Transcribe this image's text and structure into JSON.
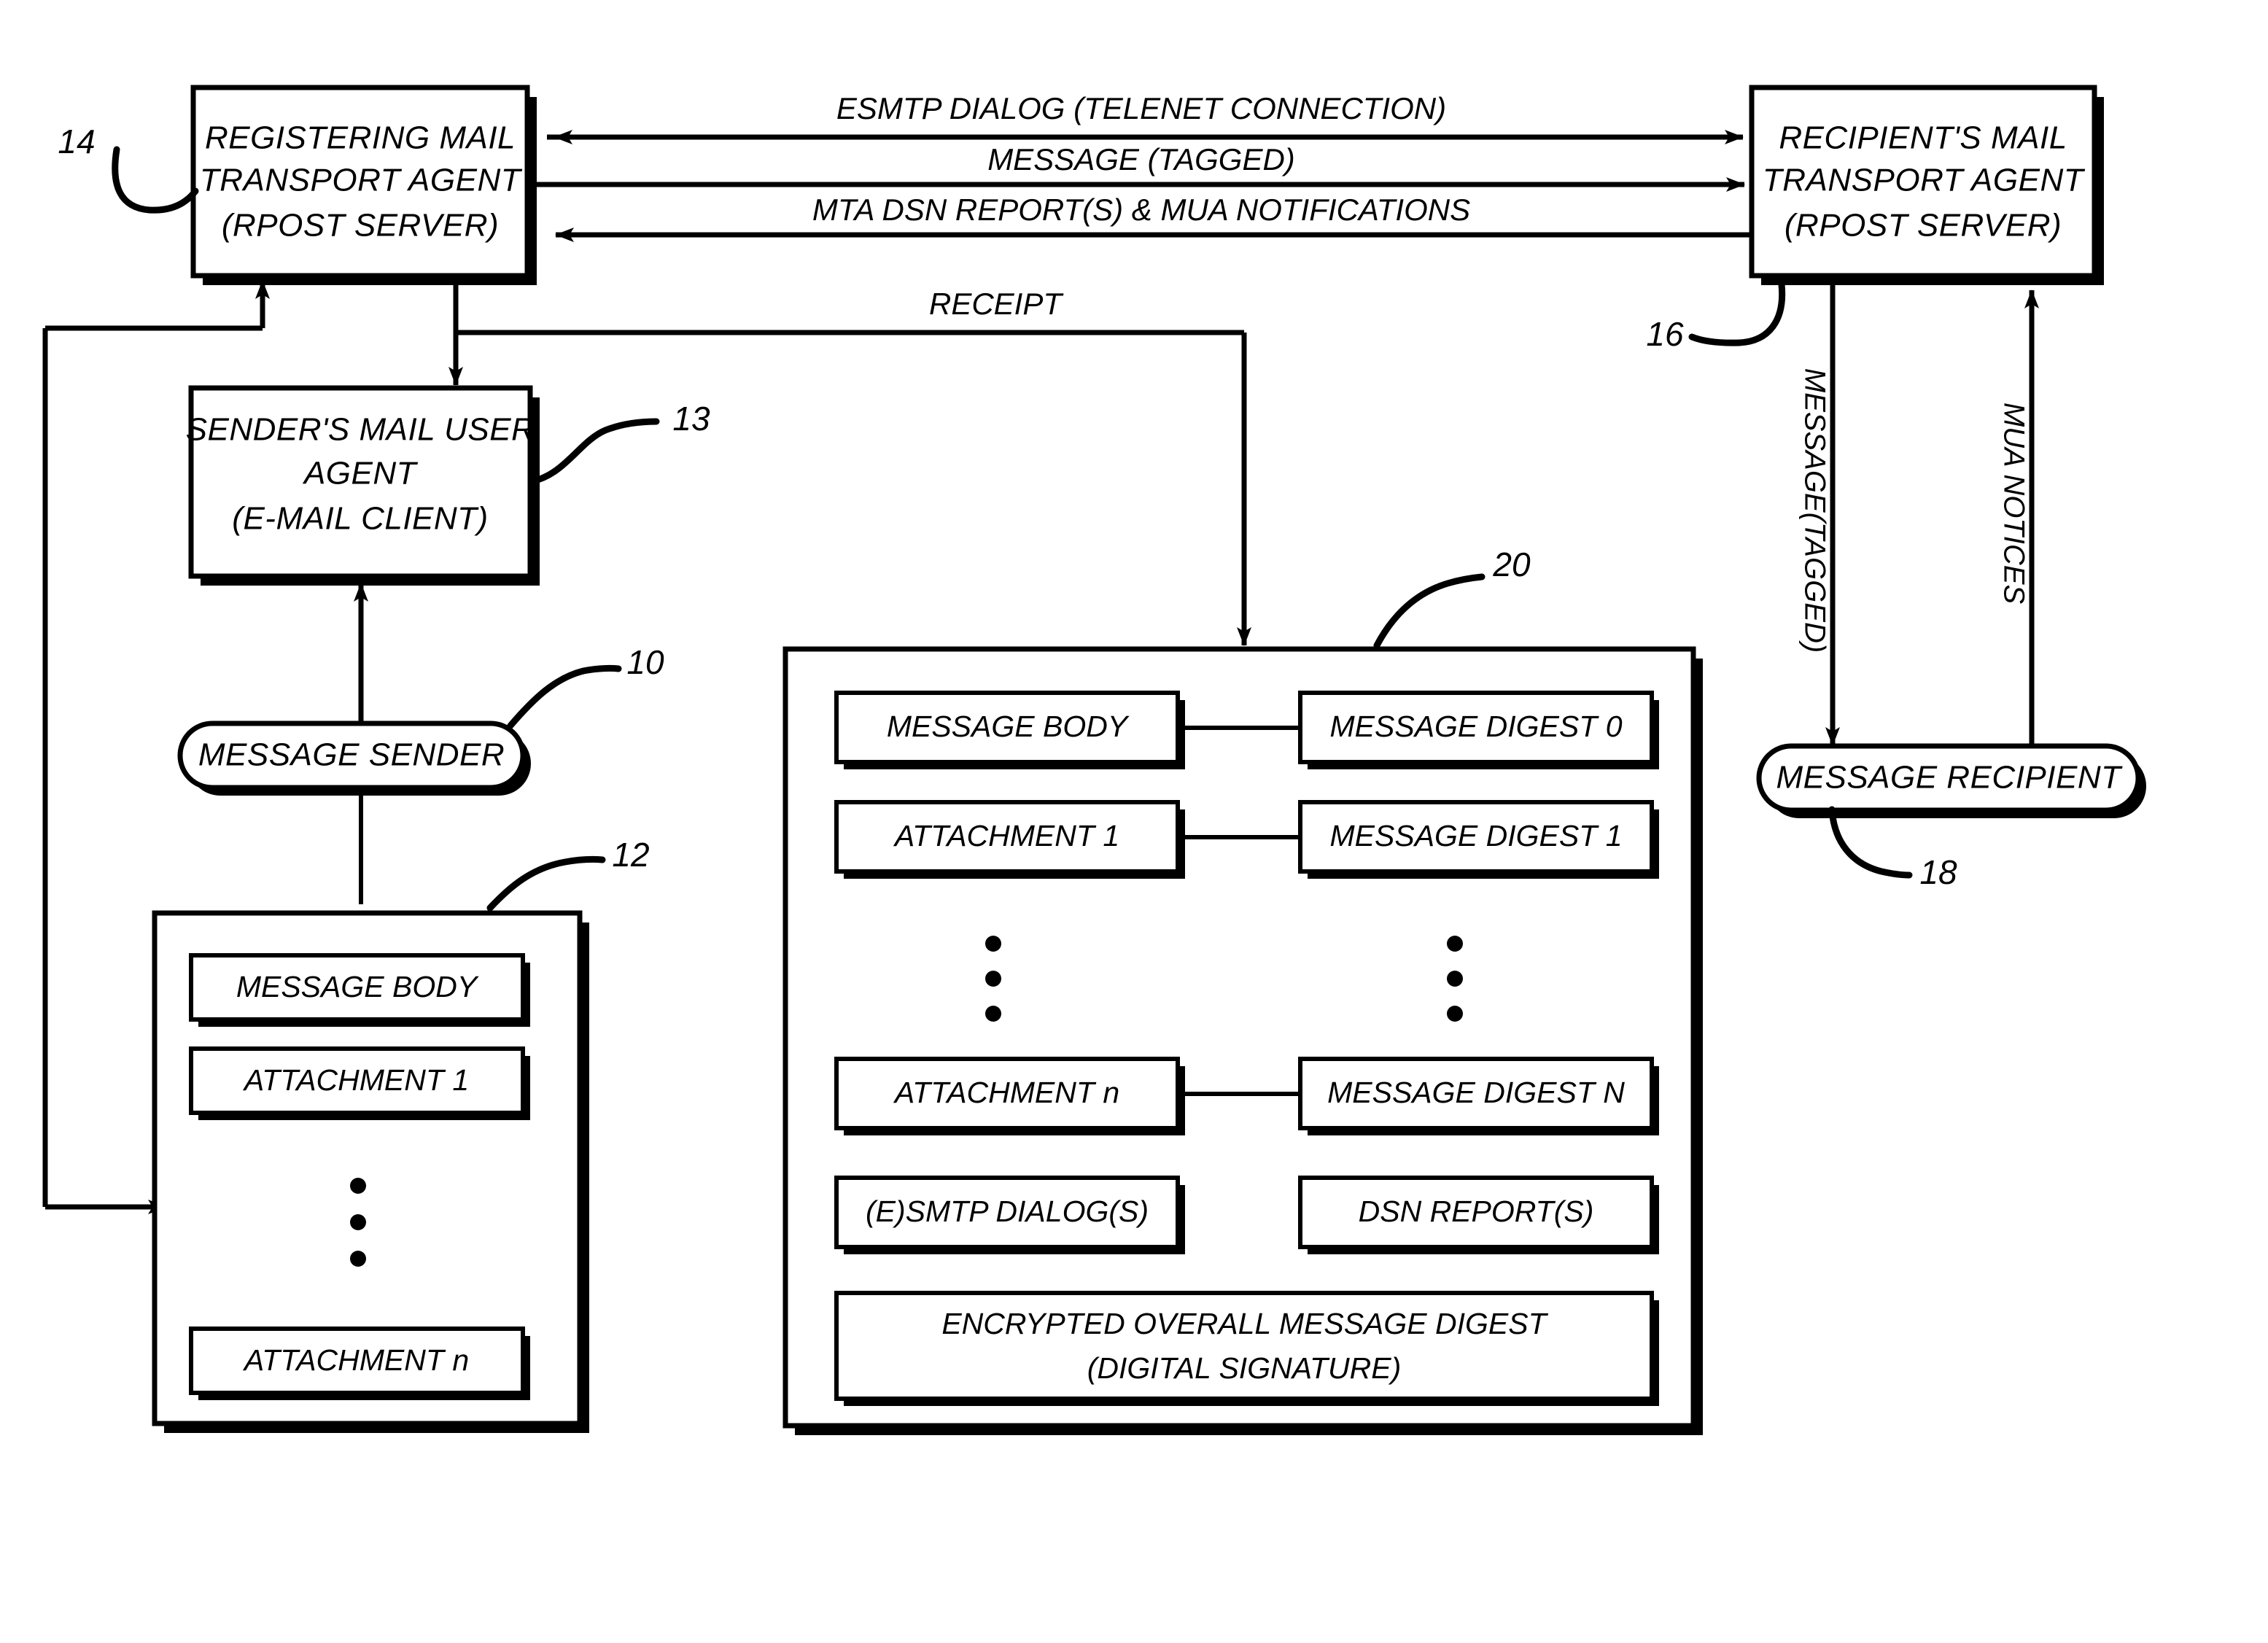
{
  "figure": {
    "title": "Registered E-Mail Message Flow Diagram",
    "background_color": "#ffffff",
    "line_color": "#000000"
  },
  "nodes": {
    "registering_mta": {
      "ref": "14",
      "lines": [
        "REGISTERING MAIL",
        "TRANSPORT AGENT",
        "(RPOST SERVER)"
      ]
    },
    "recipients_mta": {
      "ref": "16",
      "lines": [
        "RECIPIENT'S MAIL",
        "TRANSPORT AGENT",
        "(RPOST SERVER)"
      ]
    },
    "senders_mua": {
      "ref": "13",
      "lines": [
        "SENDER'S MAIL USER",
        "AGENT",
        "(E-MAIL CLIENT)"
      ]
    },
    "message_sender": {
      "ref": "10",
      "label": "MESSAGE SENDER"
    },
    "message_recipient": {
      "ref": "18",
      "label": "MESSAGE RECIPIENT"
    },
    "original_message": {
      "ref": "12",
      "items": [
        "MESSAGE BODY",
        "ATTACHMENT 1",
        "ATTACHMENT n"
      ],
      "ellipsis": "vertical-dots"
    },
    "receipt_package": {
      "ref": "20",
      "left_column": [
        "MESSAGE BODY",
        "ATTACHMENT 1",
        "ATTACHMENT n",
        "(E)SMTP DIALOG(S)"
      ],
      "right_column": [
        "MESSAGE DIGEST 0",
        "MESSAGE DIGEST 1",
        "MESSAGE DIGEST N",
        "DSN REPORT(S)"
      ],
      "footer_lines": [
        "ENCRYPTED OVERALL MESSAGE DIGEST",
        "(DIGITAL SIGNATURE)"
      ],
      "ellipsis": "vertical-dots"
    }
  },
  "flows": {
    "esmtp_dialog": "ESMTP DIALOG (TELENET CONNECTION)",
    "message_tagged": "MESSAGE (TAGGED)",
    "mta_dsn": "MTA DSN REPORT(S) & MUA NOTIFICATIONS",
    "receipt": "RECEIPT",
    "message_tagged_vertical": "MESSAGE(TAGGED)",
    "mua_notices": "MUA NOTICES"
  },
  "reference_numerals": {
    "n10": "10",
    "n12": "12",
    "n13": "13",
    "n14": "14",
    "n16": "16",
    "n18": "18",
    "n20": "20"
  }
}
